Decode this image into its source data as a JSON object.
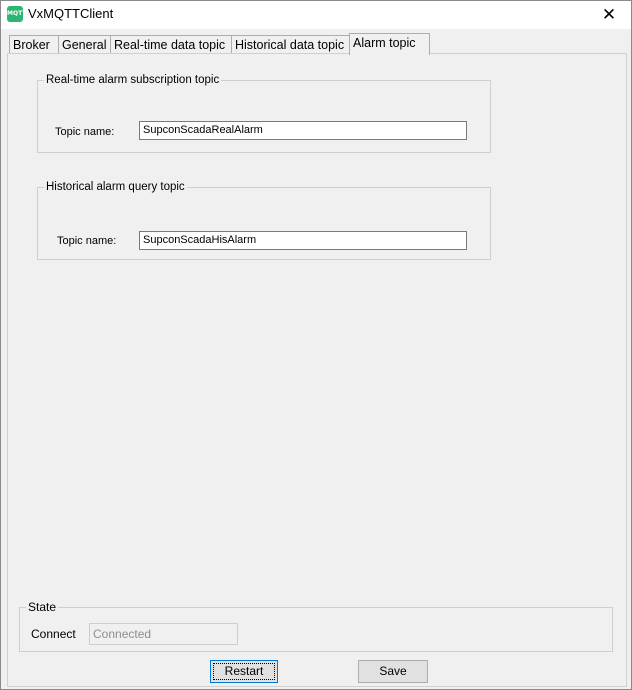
{
  "window": {
    "title": "VxMQTTClient",
    "icon": "mqtt-app-icon",
    "icon_text": "MQTT",
    "close_glyph": "✕"
  },
  "tabs": [
    {
      "label": "Broker",
      "active": false
    },
    {
      "label": "General",
      "active": false
    },
    {
      "label": "Real-time data topic",
      "active": false
    },
    {
      "label": "Historical data topic",
      "active": false
    },
    {
      "label": "Alarm topic",
      "active": true
    }
  ],
  "realtime_alarm": {
    "legend": "Real-time alarm subscription topic",
    "topic_label": "Topic name:",
    "topic_value": "SupconScadaRealAlarm"
  },
  "historical_alarm": {
    "legend": "Historical alarm query topic",
    "topic_label": "Topic name:",
    "topic_value": "SupconScadaHisAlarm"
  },
  "state": {
    "legend": "State",
    "connect_label": "Connect",
    "connect_placeholder": "Connected"
  },
  "buttons": {
    "restart": "Restart",
    "save": "Save"
  }
}
